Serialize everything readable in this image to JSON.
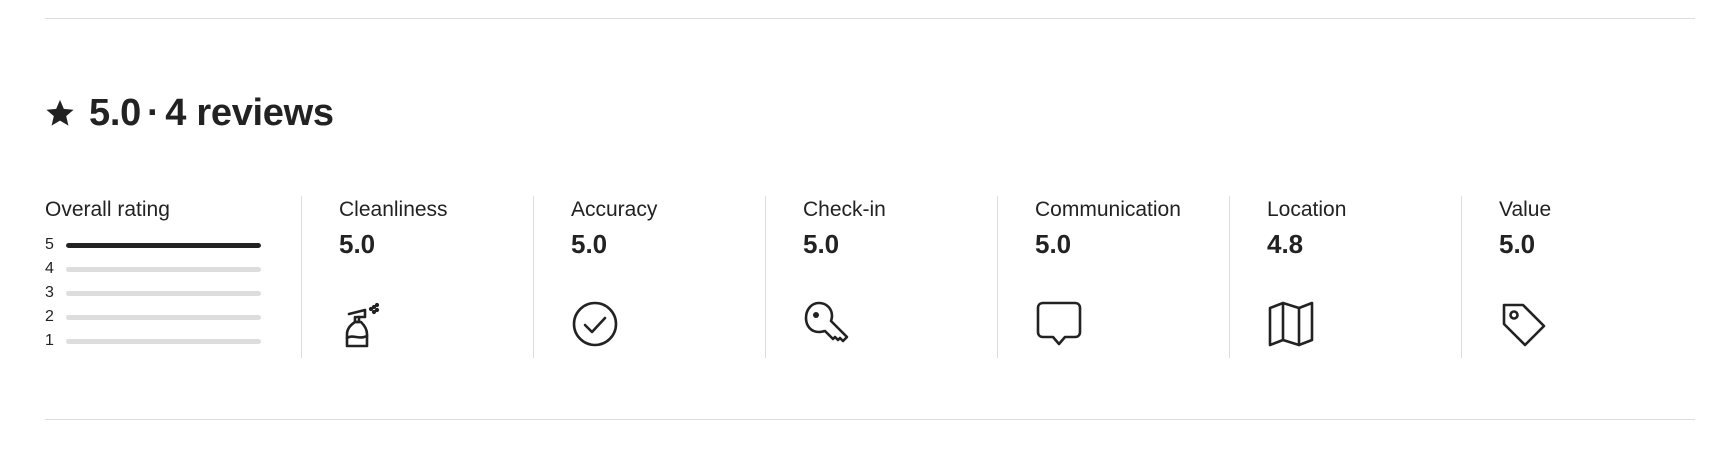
{
  "summary": {
    "icon": "star-icon",
    "rating": "5.0",
    "separator": "·",
    "reviews": "4 reviews"
  },
  "overall": {
    "title": "Overall rating",
    "bars": [
      {
        "label": "5",
        "fraction": 1.0
      },
      {
        "label": "4",
        "fraction": 0.0
      },
      {
        "label": "3",
        "fraction": 0.0
      },
      {
        "label": "2",
        "fraction": 0.0
      },
      {
        "label": "1",
        "fraction": 0.0
      }
    ]
  },
  "categories": [
    {
      "label": "Cleanliness",
      "score": "5.0",
      "icon": "spray-bottle-icon"
    },
    {
      "label": "Accuracy",
      "score": "5.0",
      "icon": "check-circle-icon"
    },
    {
      "label": "Check-in",
      "score": "5.0",
      "icon": "key-icon"
    },
    {
      "label": "Communication",
      "score": "5.0",
      "icon": "chat-bubble-icon"
    },
    {
      "label": "Location",
      "score": "4.8",
      "icon": "map-icon"
    },
    {
      "label": "Value",
      "score": "5.0",
      "icon": "price-tag-icon"
    }
  ],
  "colors": {
    "text": "#222222",
    "bar_track": "#dddddd",
    "bar_fill": "#222222",
    "divider": "#dddddd"
  }
}
